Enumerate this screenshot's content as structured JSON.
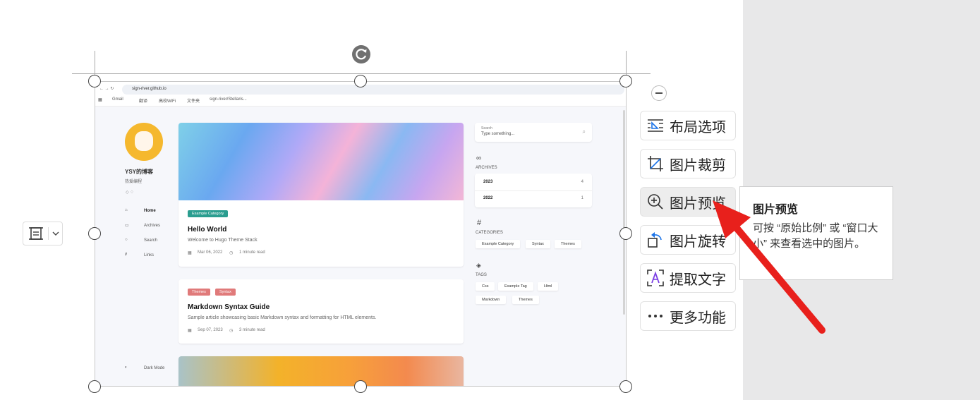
{
  "browser": {
    "url": "sign-river.github.io",
    "bookmarks": [
      "Gmail",
      "翻译",
      "高校WiFi",
      "文件夹",
      "sign-river/Stellaris..."
    ]
  },
  "blog": {
    "site_title": "YSY的博客",
    "site_subtitle": "热爱编程",
    "nav": [
      "Home",
      "Archives",
      "Search",
      "Links"
    ],
    "dark_mode": "Dark Mode",
    "posts": [
      {
        "chips": [
          "Example Category"
        ],
        "title": "Hello World",
        "summary": "Welcome to Hugo Theme Stack",
        "date": "Mar 06, 2022",
        "read": "1 minute read"
      },
      {
        "chips": [
          "Themes",
          "Syntax"
        ],
        "title": "Markdown Syntax Guide",
        "summary": "Sample article showcasing basic Markdown syntax and formatting for HTML elements.",
        "date": "Sep 07, 2023",
        "read": "3 minute read"
      }
    ],
    "search": {
      "label": "Search",
      "placeholder": "Type something..."
    },
    "archives": {
      "heading": "ARCHIVES",
      "years": [
        {
          "year": "2023",
          "count": "4"
        },
        {
          "year": "2022",
          "count": "1"
        }
      ]
    },
    "categories": {
      "heading": "CATEGORIES",
      "items": [
        "Example Category",
        "Syntax",
        "Themes"
      ]
    },
    "tags": {
      "heading": "TAGS",
      "items": [
        "Css",
        "Example Tag",
        "Html",
        "Markdown",
        "Themes"
      ]
    }
  },
  "toolbar": {
    "items": [
      {
        "label": "布局选项",
        "icon": "layout-options-icon"
      },
      {
        "label": "图片裁剪",
        "icon": "crop-icon"
      },
      {
        "label": "图片预览",
        "icon": "zoom-in-icon"
      },
      {
        "label": "图片旋转",
        "icon": "rotate-icon"
      },
      {
        "label": "提取文字",
        "icon": "extract-text-icon"
      },
      {
        "label": "更多功能",
        "icon": "more-icon"
      }
    ]
  },
  "tooltip": {
    "title": "图片预览",
    "body": "可按 “原始比例” 或 “窗口大小” 来查看选中的图片。"
  },
  "colors": {
    "chip_green": "#2a9d8f",
    "chip_red": "#e07a7a",
    "arrow": "#e8201c"
  }
}
